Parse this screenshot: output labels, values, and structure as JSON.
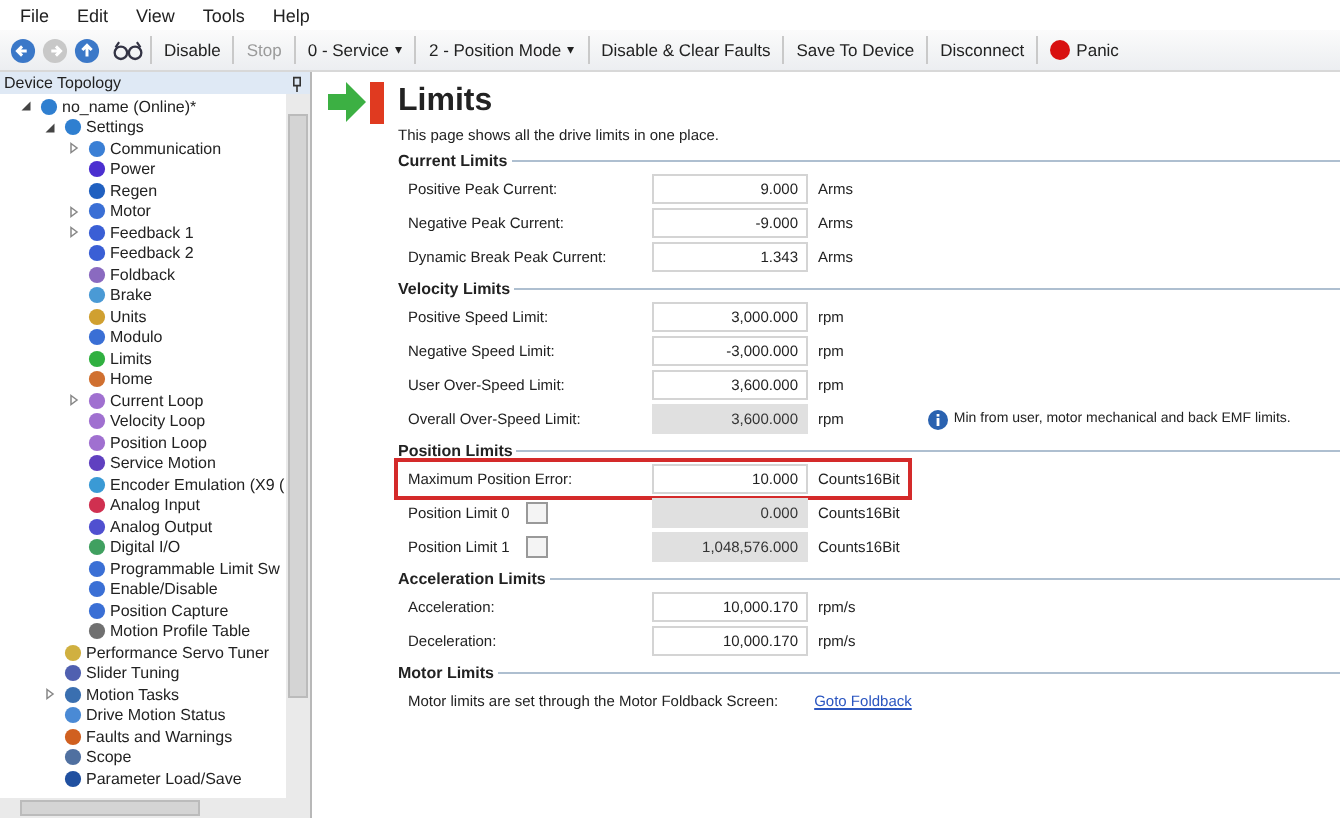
{
  "menu": [
    "File",
    "Edit",
    "View",
    "Tools",
    "Help"
  ],
  "toolbar": [
    {
      "kind": "back",
      "disabled": false
    },
    {
      "kind": "forward",
      "disabled": true
    },
    {
      "kind": "up",
      "disabled": false
    },
    {
      "kind": "glasses"
    },
    {
      "kind": "button",
      "label": "Disable",
      "disabled": false
    },
    {
      "kind": "button",
      "label": "Stop",
      "disabled": true
    },
    {
      "kind": "dropdown",
      "label": "0 - Service",
      "caret": "▾"
    },
    {
      "kind": "dropdown",
      "label": "2 - Position Mode",
      "caret": "▾"
    },
    {
      "kind": "button",
      "label": "Disable & Clear Faults",
      "disabled": false
    },
    {
      "kind": "button",
      "label": "Save To Device",
      "disabled": false
    },
    {
      "kind": "button",
      "label": "Disconnect",
      "disabled": false
    },
    {
      "kind": "panic",
      "label": "Panic"
    }
  ],
  "sidebar": {
    "title": "Device Topology",
    "tree": [
      {
        "label": "no_name (Online)*",
        "color": "#2f7fd0",
        "expanded": true,
        "children": [
          {
            "label": "Settings",
            "color": "#2f7fd0",
            "expanded": true,
            "children": [
              {
                "label": "Communication",
                "color": "#3a7fd5",
                "expanded": false
              },
              {
                "label": "Power",
                "color": "#4b2fd0"
              },
              {
                "label": "Regen",
                "color": "#2060c0"
              },
              {
                "label": "Motor",
                "color": "#3a6fd5",
                "expanded": false
              },
              {
                "label": "Feedback 1",
                "color": "#3a5fd5",
                "expanded": false
              },
              {
                "label": "Feedback 2",
                "color": "#3a5fd5"
              },
              {
                "label": "Foldback",
                "color": "#8a6ac0"
              },
              {
                "label": "Brake",
                "color": "#4a9ad5"
              },
              {
                "label": "Units",
                "color": "#d0a030"
              },
              {
                "label": "Modulo",
                "color": "#3a6fd5"
              },
              {
                "label": "Limits",
                "color": "#30b040"
              },
              {
                "label": "Home",
                "color": "#d07030"
              },
              {
                "label": "Current Loop",
                "color": "#a070d0",
                "expanded": false
              },
              {
                "label": "Velocity Loop",
                "color": "#a070d0"
              },
              {
                "label": "Position Loop",
                "color": "#a070d0"
              },
              {
                "label": "Service Motion",
                "color": "#6040c0"
              },
              {
                "label": "Encoder Emulation (X9 (",
                "color": "#3a9ad5"
              },
              {
                "label": "Analog Input",
                "color": "#d03050"
              },
              {
                "label": "Analog Output",
                "color": "#5050d0"
              },
              {
                "label": "Digital I/O",
                "color": "#40a060"
              },
              {
                "label": "Programmable Limit Sw",
                "color": "#3a6fd5"
              },
              {
                "label": "Enable/Disable",
                "color": "#3a6fd5"
              },
              {
                "label": "Position Capture",
                "color": "#3a6fd5"
              },
              {
                "label": "Motion Profile Table",
                "color": "#707070"
              }
            ]
          },
          {
            "label": "Performance Servo Tuner",
            "color": "#d0b040"
          },
          {
            "label": "Slider Tuning",
            "color": "#5060b0"
          },
          {
            "label": "Motion Tasks",
            "color": "#3a6fb0",
            "expanded": false
          },
          {
            "label": "Drive Motion Status",
            "color": "#4a8ad5"
          },
          {
            "label": "Faults and Warnings",
            "color": "#d06020"
          },
          {
            "label": "Scope",
            "color": "#5070a0"
          },
          {
            "label": "Parameter Load/Save",
            "color": "#2050a0"
          }
        ]
      }
    ]
  },
  "page": {
    "title": "Limits",
    "description": "This page shows all the drive limits in one place.",
    "groups": [
      {
        "title": "Current Limits",
        "rows": [
          {
            "kind": "field",
            "label": "Positive Peak Current:",
            "value": "9.000",
            "unit": "Arms",
            "readonly": false,
            "highlighted": false
          },
          {
            "kind": "field",
            "label": "Negative Peak Current:",
            "value": "-9.000",
            "unit": "Arms",
            "readonly": false,
            "highlighted": false
          },
          {
            "kind": "field",
            "label": "Dynamic Break Peak Current:",
            "value": "1.343",
            "unit": "Arms",
            "readonly": false,
            "highlighted": false
          }
        ]
      },
      {
        "title": "Velocity Limits",
        "rows": [
          {
            "kind": "field",
            "label": "Positive Speed Limit:",
            "value": "3,000.000",
            "unit": "rpm",
            "readonly": false,
            "highlighted": false
          },
          {
            "kind": "field",
            "label": "Negative Speed Limit:",
            "value": "-3,000.000",
            "unit": "rpm",
            "readonly": false,
            "highlighted": false
          },
          {
            "kind": "field",
            "label": "User Over-Speed Limit:",
            "value": "3,600.000",
            "unit": "rpm",
            "readonly": false,
            "highlighted": false
          },
          {
            "kind": "field",
            "label": "Overall Over-Speed Limit:",
            "value": "3,600.000",
            "unit": "rpm",
            "readonly": true,
            "highlighted": false,
            "note": "Min from user, motor mechanical and back EMF limits."
          }
        ]
      },
      {
        "title": "Position Limits",
        "rows": [
          {
            "kind": "field",
            "label": "Maximum Position Error:",
            "value": "10.000",
            "unit": "Counts16Bit",
            "readonly": false,
            "highlighted": true
          },
          {
            "kind": "checkbox_field",
            "label": "Position Limit 0",
            "checked": false,
            "value": "0.000",
            "unit": "Counts16Bit",
            "readonly": true,
            "highlighted": false
          },
          {
            "kind": "checkbox_field",
            "label": "Position Limit 1",
            "checked": false,
            "value": "1,048,576.000",
            "unit": "Counts16Bit",
            "readonly": true,
            "highlighted": false
          }
        ]
      },
      {
        "title": "Acceleration Limits",
        "rows": [
          {
            "kind": "field",
            "label": "Acceleration:",
            "value": "10,000.170",
            "unit": "rpm/s",
            "readonly": false,
            "highlighted": false
          },
          {
            "kind": "field",
            "label": "Deceleration:",
            "value": "10,000.170",
            "unit": "rpm/s",
            "readonly": false,
            "highlighted": false
          }
        ]
      },
      {
        "title": "Motor Limits",
        "rows": [
          {
            "kind": "link",
            "label": "Motor limits are set through the Motor Foldback Screen:",
            "link": "Goto Foldback"
          }
        ]
      }
    ]
  }
}
